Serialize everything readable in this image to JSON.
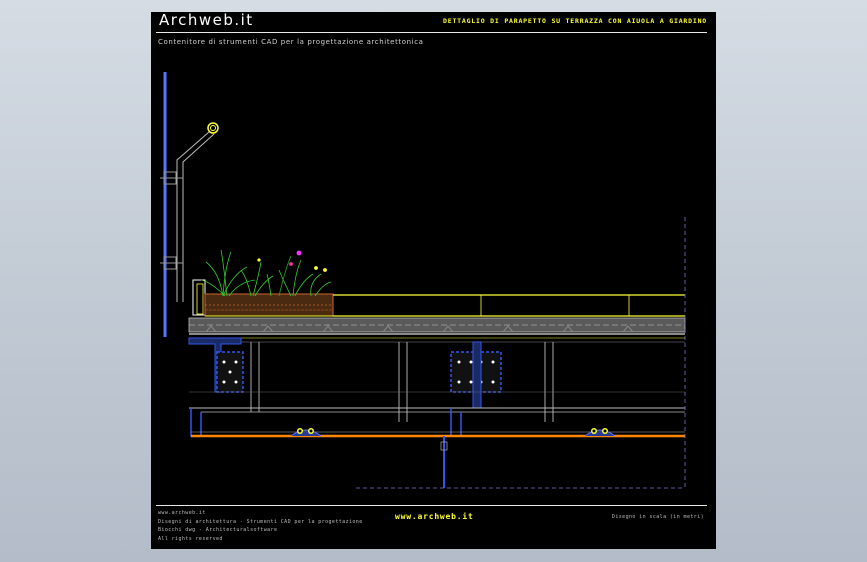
{
  "sheet": {
    "brand_title": "Archweb.it",
    "drawing_title": "DETTAGLIO DI PARAPETTO SU TERRAZZA CON AIUOLA A GIARDINO",
    "subtitle": "Contenitore di strumenti CAD per la progettazione architettonica",
    "footer": {
      "left_lines": [
        "www.archweb.it",
        "Disegni di architettura - Strumenti CAD  per la progettazione",
        "Biocchi dwg - Architecturalsoftware",
        "All rights reserved"
      ],
      "center_url": "www.archweb.it",
      "right_note": "Disegno in scala (in metri)"
    }
  },
  "colors": {
    "background": "#000000",
    "title_yellow": "#ffff33",
    "railing_blue": "#5577ff",
    "structure_gray": "#9a9a9a",
    "beam_blue": "#3355ee",
    "insulation_orange": "#ff8800",
    "planter_yellow": "#ffff33",
    "plants_green": "#33cc33"
  }
}
